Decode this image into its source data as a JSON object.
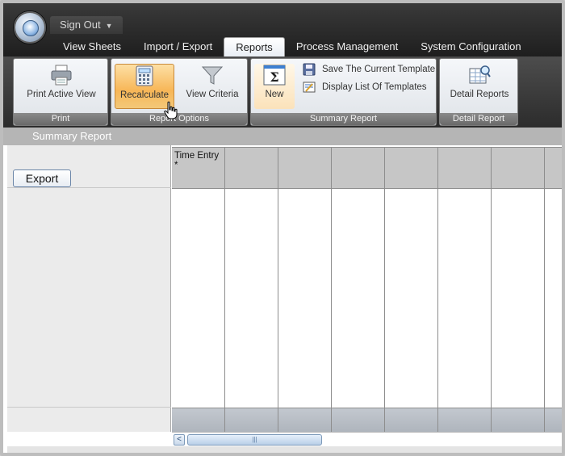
{
  "app": {
    "signout_label": "Sign Out",
    "signout_caret": "▼"
  },
  "tabs": [
    {
      "label": "View Sheets",
      "active": false
    },
    {
      "label": "Import / Export",
      "active": false
    },
    {
      "label": "Reports",
      "active": true
    },
    {
      "label": "Process Management",
      "active": false
    },
    {
      "label": "System Configuration",
      "active": false
    }
  ],
  "ribbon": {
    "print_group": {
      "label": "Print",
      "print_active_view": "Print Active View"
    },
    "report_options_group": {
      "label": "Report Options",
      "recalculate": "Recalculate",
      "view_criteria": "View Criteria"
    },
    "summary_report_group": {
      "label": "Summary Report",
      "new": "New",
      "save_template": "Save The Current Template",
      "display_templates": "Display List Of Templates"
    },
    "detail_report_group": {
      "label": "Detail Report",
      "detail_reports": "Detail Reports"
    }
  },
  "summary": {
    "title": "Summary Report",
    "export_label": "Export",
    "columns": [
      "Time Entry *",
      "",
      "",
      "",
      "",
      "",
      "",
      ""
    ]
  },
  "scrollbar": {
    "left_arrow": "<",
    "thumb_grip": "|||"
  },
  "colors": {
    "topbar": "#2a2a2a",
    "active_button": "#f7b657",
    "header_cell": "#c6c6c6",
    "summary_bar": "#b5b5b5"
  }
}
